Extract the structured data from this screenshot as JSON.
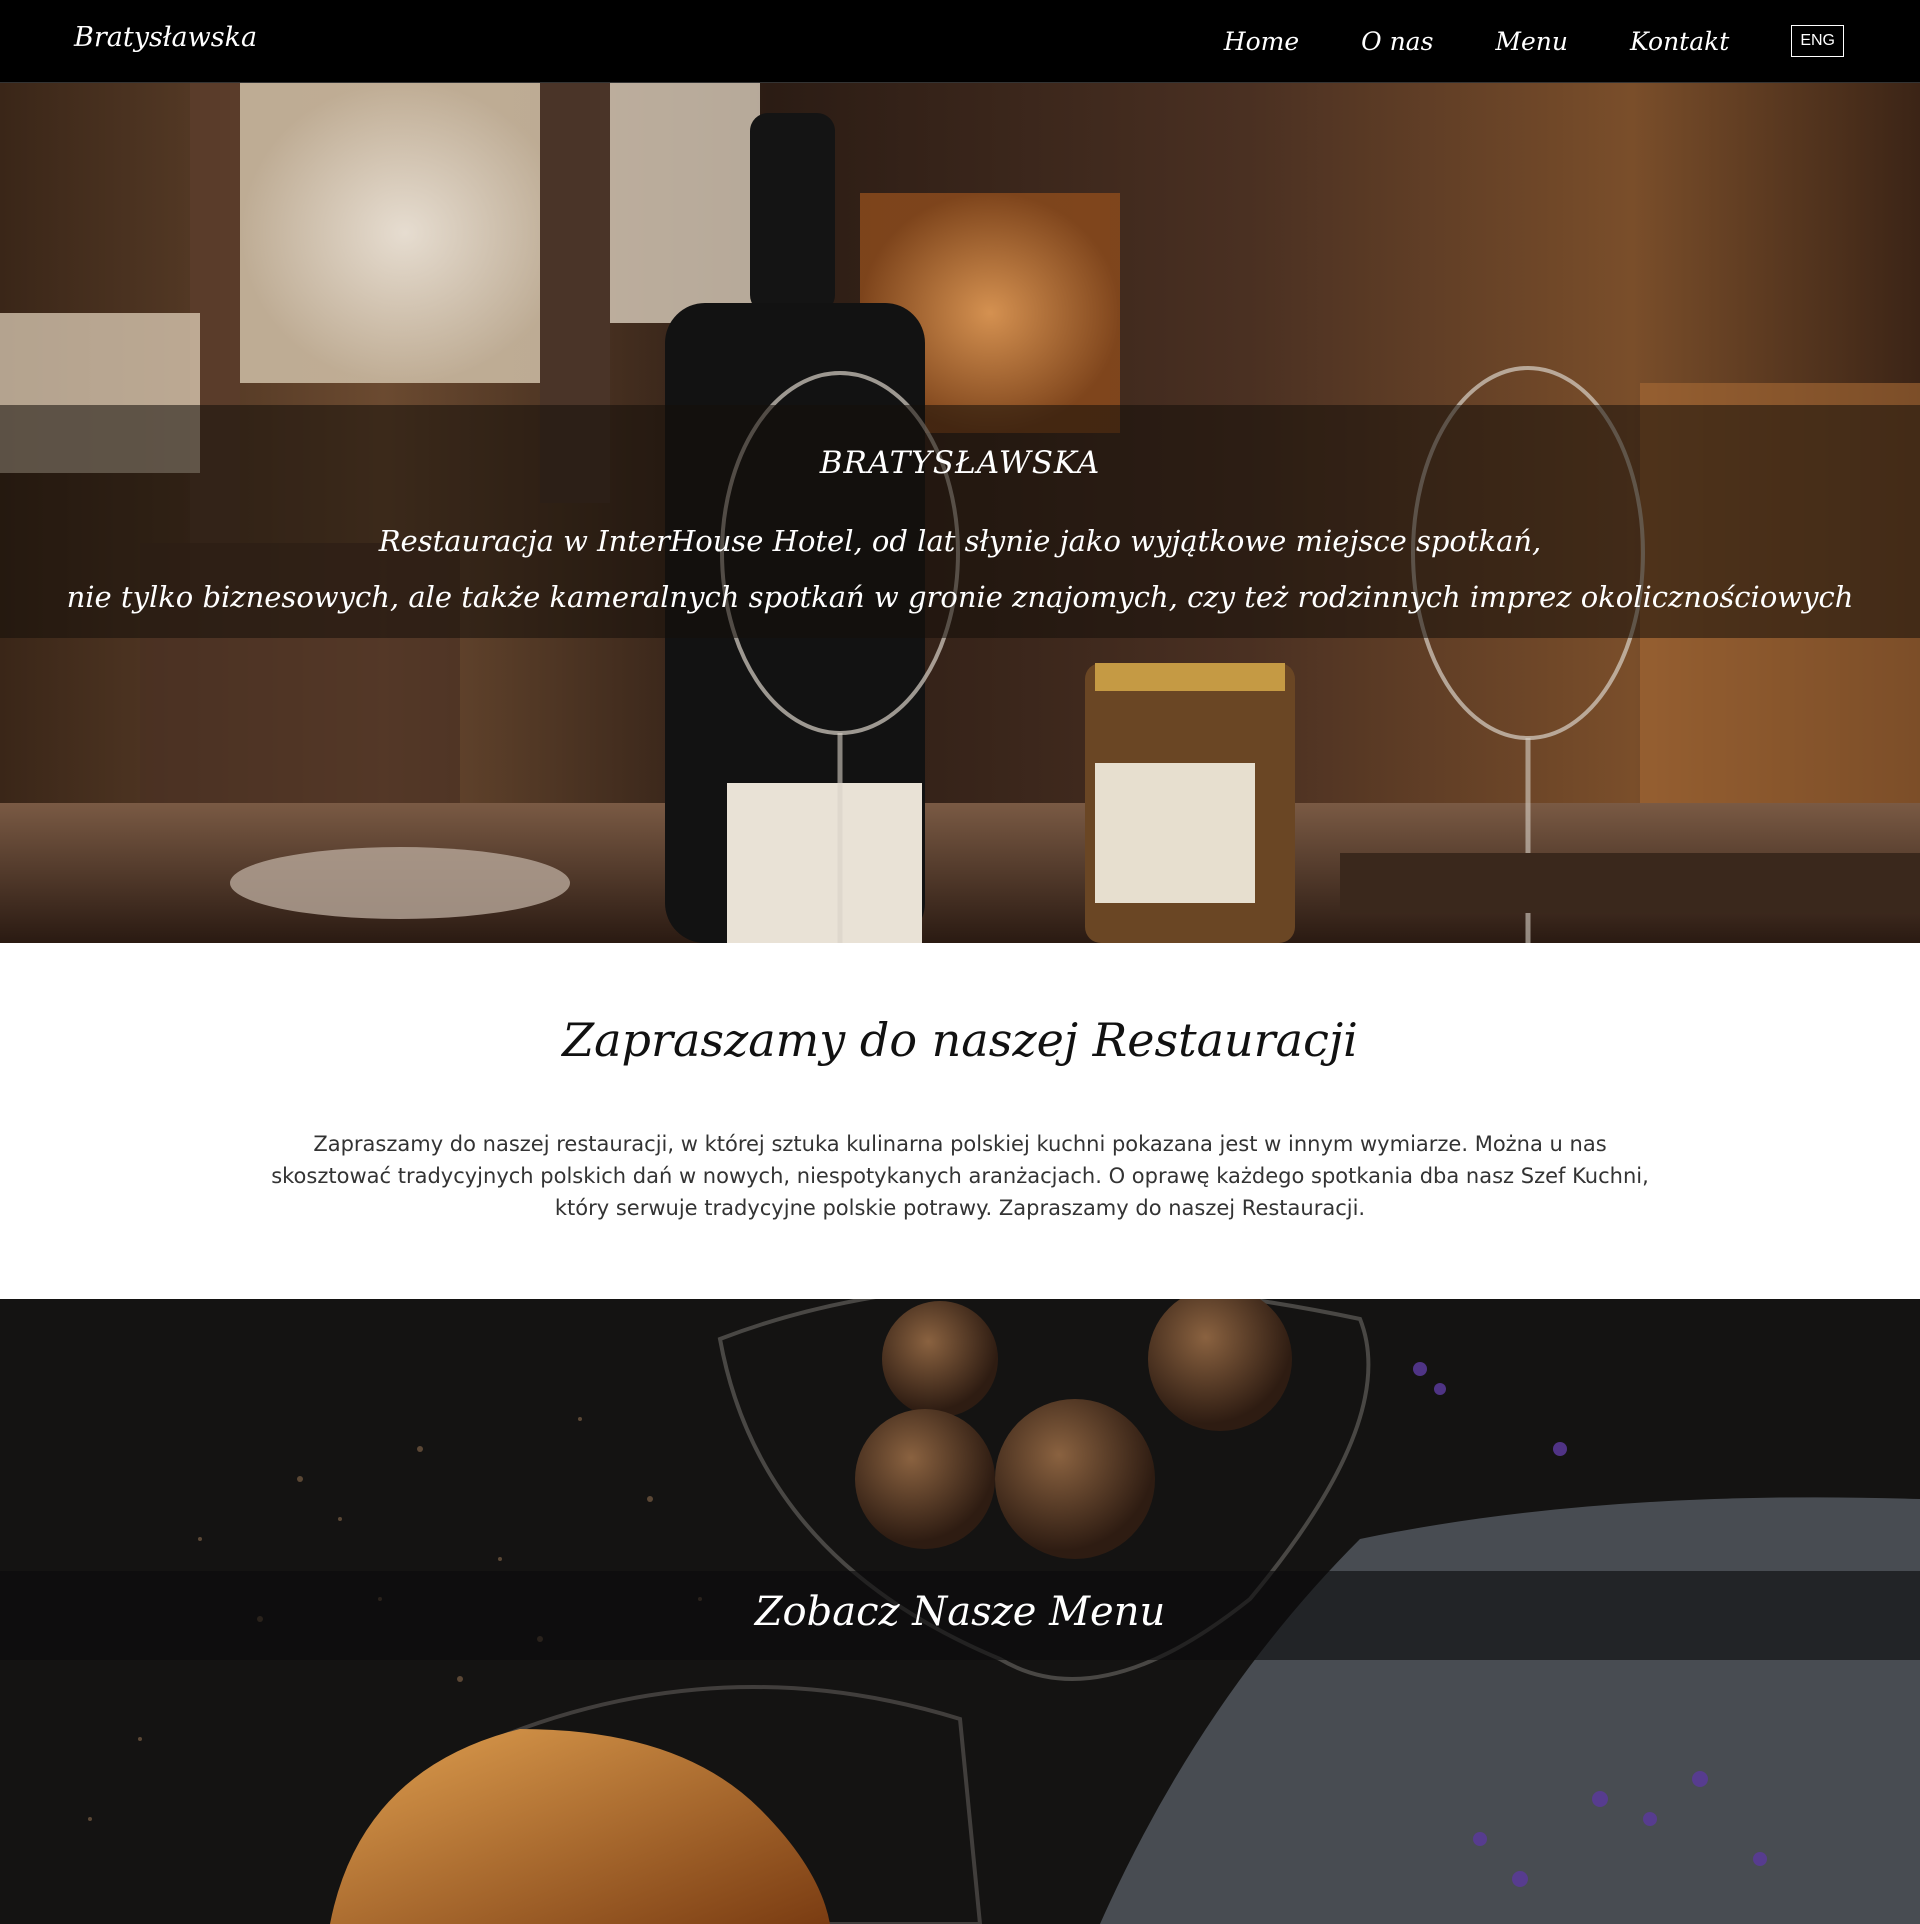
{
  "navbar": {
    "brand": "Bratysławska",
    "items": [
      {
        "label": "Home"
      },
      {
        "label": "O nas"
      },
      {
        "label": "Menu"
      },
      {
        "label": "Kontakt"
      }
    ],
    "lang_button": "ENG"
  },
  "hero": {
    "title": "BRATYSŁAWSKA",
    "line1": "Restauracja w InterHouse Hotel, od lat słynie jako wyjątkowe miejsce spotkań,",
    "line2": "nie tylko biznesowych, ale także kameralnych spotkań w gronie znajomych, czy też rodzinnych imprez okolicznościowych"
  },
  "welcome": {
    "title": "Zapraszamy do naszej Restauracji",
    "paragraph": "Zapraszamy do naszej restauracji, w której sztuka kulinarna polskiej kuchni pokazana jest w innym wymiarze. Można u nas skosztować tradycyjnych polskich dań w nowych, niespotykanych aranżacjach. O oprawę każdego spotkania dba nasz Szef Kuchni, który serwuje tradycyjne polskie potrawy. Zapraszamy do naszej Restauracji."
  },
  "menu_banner": {
    "title": "Zobacz Nasze Menu"
  },
  "colors": {
    "navbar_bg": "#000000",
    "hero_band": "#140e0a",
    "text_light": "#ffffff",
    "text_dark": "#111111"
  }
}
